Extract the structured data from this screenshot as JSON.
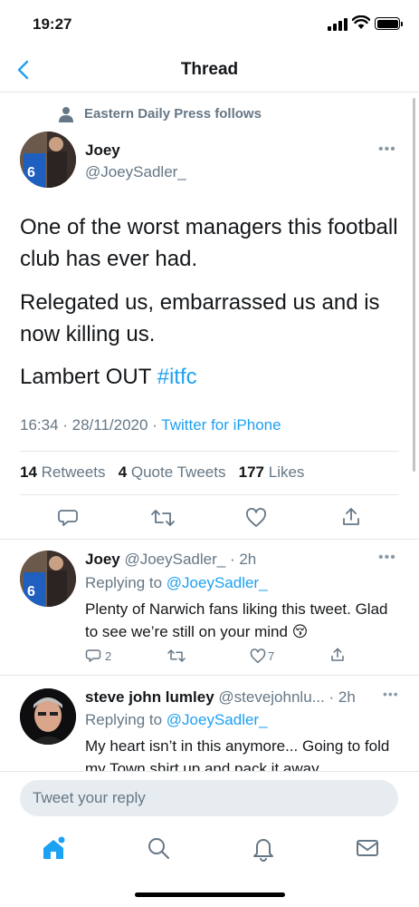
{
  "status_bar": {
    "time": "19:27"
  },
  "nav": {
    "title": "Thread"
  },
  "main_tweet": {
    "social_context": "Eastern Daily Press follows",
    "name": "Joey",
    "handle": "@JoeySadler_",
    "paragraphs": [
      "One of the worst managers this football club has ever had.",
      "Relegated us, embarrassed us and is now killing us."
    ],
    "last_line_text": "Lambert OUT ",
    "hashtag": "#itfc",
    "timestamp": "16:34 · 28/11/2020 · ",
    "source": "Twitter for iPhone",
    "retweets_count": "14",
    "retweets_label": " Retweets",
    "quotes_count": "4",
    "quotes_label": " Quote Tweets",
    "likes_count": "177",
    "likes_label": " Likes"
  },
  "replies": [
    {
      "name": "Joey",
      "handle": " @JoeySadler_",
      "time": " · 2h",
      "replying_label": "Replying to ",
      "replying_handle": "@JoeySadler_",
      "text": "Plenty of Narwich fans liking this tweet. Glad to see we’re still on your mind 😚",
      "reply_count": "2",
      "like_count": "7"
    },
    {
      "name": "steve john lumley",
      "handle": " @stevejohnlu...",
      "time": " · 2h",
      "replying_label": "Replying to ",
      "replying_handle": "@JoeySadler_",
      "text": "My heart isn’t in this anymore... Going to fold my Town shirt up and pack it away"
    }
  ],
  "composer": {
    "placeholder": "Tweet your reply"
  },
  "colors": {
    "accent": "#1da1f2",
    "secondary_text": "#657786",
    "divider": "#e1e8ed"
  }
}
